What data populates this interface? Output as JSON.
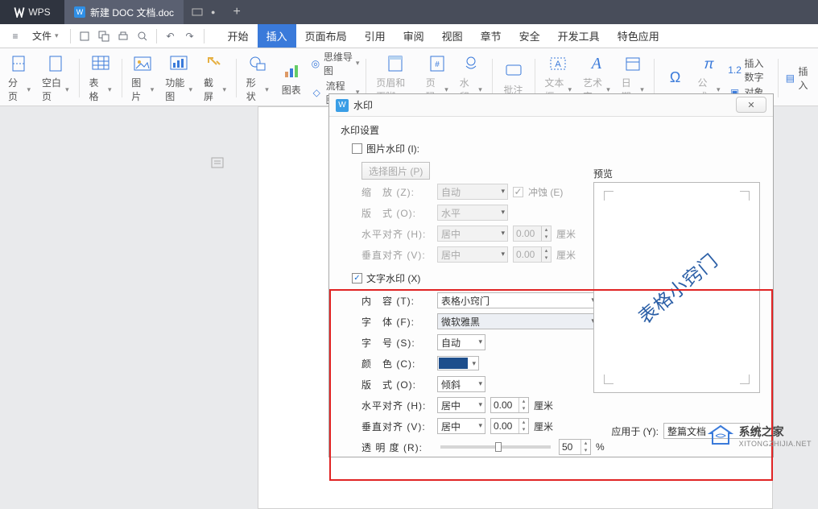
{
  "titlebar": {
    "app_logo": "WPS",
    "doc_name": "新建 DOC 文档.doc",
    "new_tab_plus": "+"
  },
  "menu": {
    "file": "文件",
    "tabs": [
      "开始",
      "插入",
      "页面布局",
      "引用",
      "审阅",
      "视图",
      "章节",
      "安全",
      "开发工具",
      "特色应用"
    ],
    "active_index": 1
  },
  "ribbon": {
    "groups": {
      "page_break": "分页",
      "blank_page": "空白页",
      "table": "表格",
      "picture": "图片",
      "featured": "功能图",
      "screenshot": "截屏",
      "shape": "形状",
      "chart": "图表",
      "mindmap": "思维导图",
      "flowchart": "流程图",
      "header_footer": "页眉和页脚",
      "page_num": "页码",
      "watermark": "水印",
      "something": "批注",
      "textbox": "文本框",
      "wordart": "艺术字",
      "date": "日期",
      "symbol_pi": "π",
      "equation": "公式",
      "insert_number": "插入数字",
      "object": "对象",
      "insert": "插入"
    }
  },
  "dialog": {
    "title": "水印",
    "section": "水印设置",
    "pic_wm_label": "图片水印 (I):",
    "select_pic": "选择图片 (P)",
    "zoom_label": "缩　放 (Z):",
    "zoom_value": "自动",
    "washout_label": "冲蚀 (E)",
    "layout_label": "版　式 (O):",
    "layout_value": "水平",
    "halign_label": "水平对齐 (H):",
    "halign_value": "居中",
    "halign_num": "0.00",
    "halign_unit": "厘米",
    "valign_label": "垂直对齐 (V):",
    "valign_value": "居中",
    "valign_num": "0.00",
    "valign_unit": "厘米",
    "text_wm_label": "文字水印 (X)",
    "content_label": "内　容 (T):",
    "content_value": "表格小窍门",
    "font_label": "字　体 (F):",
    "font_value": "微软雅黑",
    "size_label": "字　号 (S):",
    "size_value": "自动",
    "color_label": "颜　色 (C):",
    "layout2_label": "版　式 (O):",
    "layout2_value": "倾斜",
    "halign2_label": "水平对齐 (H):",
    "halign2_value": "居中",
    "halign2_num": "0.00",
    "halign2_unit": "厘米",
    "valign2_label": "垂直对齐 (V):",
    "valign2_value": "居中",
    "valign2_num": "0.00",
    "valign2_unit": "厘米",
    "opacity_label": "透 明 度 (R):",
    "opacity_value": "50",
    "opacity_unit": "%",
    "preview_label": "预览",
    "preview_text": "表格小窍门",
    "apply_label": "应用于 (Y):",
    "apply_value": "整篇文档"
  },
  "brand": {
    "name": "系统之家",
    "url": "XITONGZHIJIA.NET"
  }
}
